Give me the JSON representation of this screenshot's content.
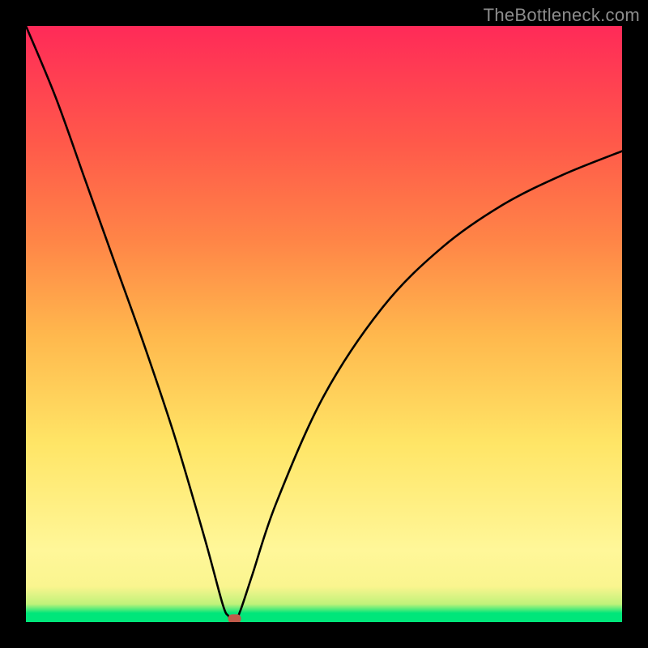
{
  "watermark": "TheBottleneck.com",
  "chart_data": {
    "type": "line",
    "title": "",
    "xlabel": "",
    "ylabel": "",
    "xlim": [
      0,
      100
    ],
    "ylim": [
      0,
      100
    ],
    "grid": false,
    "legend": false,
    "annotations": {
      "marker_x": 35,
      "marker_y": 0.5,
      "marker_color": "#c05a4a"
    },
    "gradient_stops": [
      {
        "pos": 0,
        "color": "#00e67a"
      },
      {
        "pos": 1.5,
        "color": "#00e67a"
      },
      {
        "pos": 3,
        "color": "#bff27a"
      },
      {
        "pos": 6,
        "color": "#faf58f"
      },
      {
        "pos": 12,
        "color": "#fff799"
      },
      {
        "pos": 30,
        "color": "#ffe566"
      },
      {
        "pos": 48,
        "color": "#ffb84d"
      },
      {
        "pos": 64,
        "color": "#ff8547"
      },
      {
        "pos": 80,
        "color": "#ff5a4a"
      },
      {
        "pos": 100,
        "color": "#ff2a58"
      }
    ],
    "series": [
      {
        "name": "bottleneck-curve",
        "x": [
          0,
          5,
          10,
          15,
          20,
          25,
          30,
          33,
          34,
          35,
          36,
          38,
          42,
          50,
          60,
          70,
          80,
          90,
          100
        ],
        "values": [
          100,
          88,
          74,
          60,
          46,
          31,
          14,
          3,
          1,
          0,
          2,
          8,
          20,
          38,
          53,
          63,
          70,
          75,
          79
        ]
      }
    ]
  }
}
